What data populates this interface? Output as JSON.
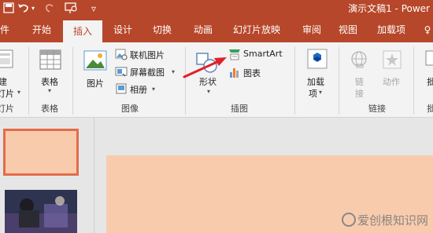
{
  "window": {
    "title": "演示文稿1  -  Power"
  },
  "quick_access": {
    "save_icon": "save-icon",
    "undo_icon": "undo-icon",
    "redo_icon": "redo-icon",
    "present_icon": "present-from-start-icon",
    "customize_icon": "chevron-down-icon"
  },
  "tabs": [
    {
      "label": "件"
    },
    {
      "label": "开始"
    },
    {
      "label": "插入",
      "active": true
    },
    {
      "label": "设计"
    },
    {
      "label": "切换"
    },
    {
      "label": "动画"
    },
    {
      "label": "幻灯片放映"
    },
    {
      "label": "审阅"
    },
    {
      "label": "视图"
    },
    {
      "label": "加载项"
    },
    {
      "label": "♀"
    }
  ],
  "ribbon": {
    "slides": {
      "label_line1": "建",
      "label_line2": "灯片",
      "group": "灯片"
    },
    "tables": {
      "button": "表格",
      "group": "表格"
    },
    "images": {
      "pictures": "图片",
      "online_pictures": "联机图片",
      "screenshot": "屏幕截图",
      "album": "相册",
      "group": "图像"
    },
    "illustrations": {
      "shapes": "形状",
      "smartart": "SmartArt",
      "chart": "图表",
      "group": "插图"
    },
    "addins": {
      "button_line1": "加载",
      "button_line2": "项"
    },
    "links": {
      "link_line1": "链",
      "link_line2": "接",
      "action": "动作",
      "group": "链接"
    },
    "right_edge": {
      "label": "批",
      "group": "批"
    }
  },
  "colors": {
    "accent": "#b7472a",
    "slide_fill": "#f8cbad",
    "thumb_border": "#e46c4a",
    "annotation_arrow": "#e0202a"
  },
  "watermark": {
    "text": "爱创根知识网"
  }
}
